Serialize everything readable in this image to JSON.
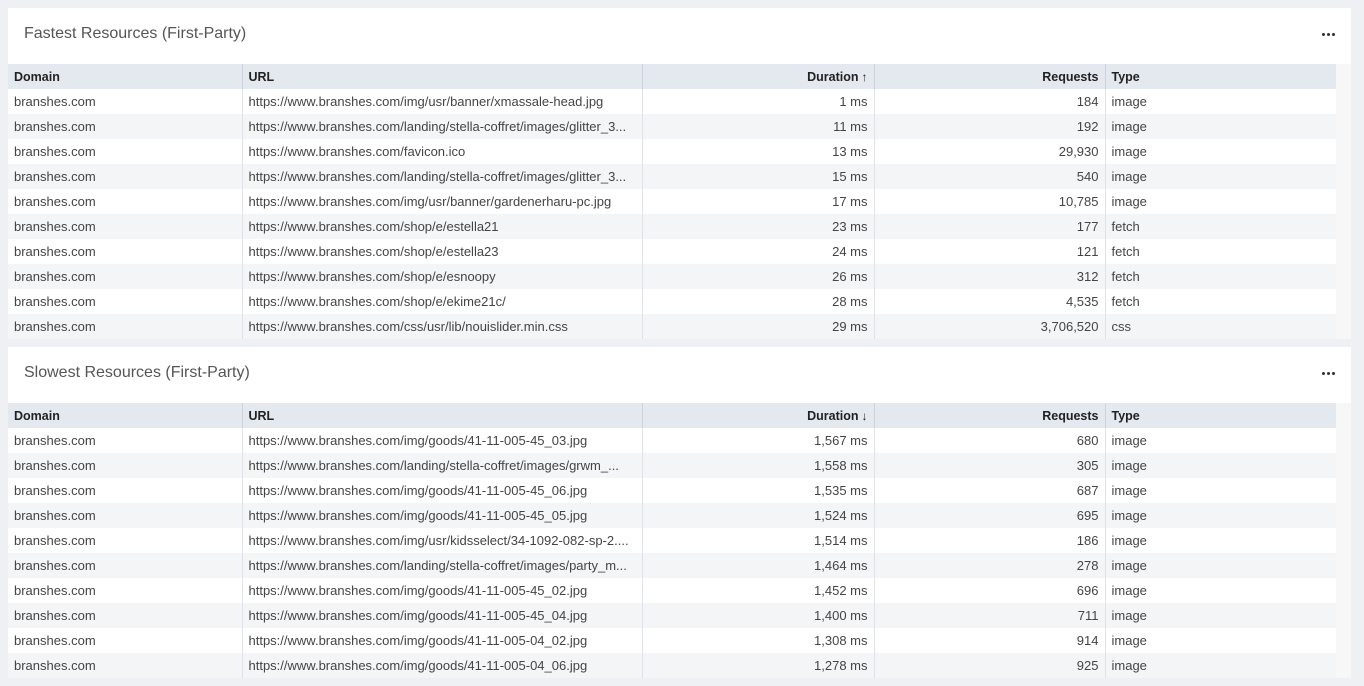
{
  "fastest": {
    "title": "Fastest Resources (First-Party)",
    "columns": {
      "domain": "Domain",
      "url": "URL",
      "duration": "Duration",
      "requests": "Requests",
      "type": "Type"
    },
    "sort_icon": "↑",
    "sort_icon_name": "sort-ascending-icon",
    "rows": [
      {
        "domain": "branshes.com",
        "url": "https://www.branshes.com/img/usr/banner/xmassale-head.jpg",
        "duration": "1 ms",
        "requests": "184",
        "type": "image"
      },
      {
        "domain": "branshes.com",
        "url": "https://www.branshes.com/landing/stella-coffret/images/glitter_3...",
        "duration": "11 ms",
        "requests": "192",
        "type": "image"
      },
      {
        "domain": "branshes.com",
        "url": "https://www.branshes.com/favicon.ico",
        "duration": "13 ms",
        "requests": "29,930",
        "type": "image"
      },
      {
        "domain": "branshes.com",
        "url": "https://www.branshes.com/landing/stella-coffret/images/glitter_3...",
        "duration": "15 ms",
        "requests": "540",
        "type": "image"
      },
      {
        "domain": "branshes.com",
        "url": "https://www.branshes.com/img/usr/banner/gardenerharu-pc.jpg",
        "duration": "17 ms",
        "requests": "10,785",
        "type": "image"
      },
      {
        "domain": "branshes.com",
        "url": "https://www.branshes.com/shop/e/estella21",
        "duration": "23 ms",
        "requests": "177",
        "type": "fetch"
      },
      {
        "domain": "branshes.com",
        "url": "https://www.branshes.com/shop/e/estella23",
        "duration": "24 ms",
        "requests": "121",
        "type": "fetch"
      },
      {
        "domain": "branshes.com",
        "url": "https://www.branshes.com/shop/e/esnoopy",
        "duration": "26 ms",
        "requests": "312",
        "type": "fetch"
      },
      {
        "domain": "branshes.com",
        "url": "https://www.branshes.com/shop/e/ekime21c/",
        "duration": "28 ms",
        "requests": "4,535",
        "type": "fetch"
      },
      {
        "domain": "branshes.com",
        "url": "https://www.branshes.com/css/usr/lib/nouislider.min.css",
        "duration": "29 ms",
        "requests": "3,706,520",
        "type": "css"
      }
    ]
  },
  "slowest": {
    "title": "Slowest Resources (First-Party)",
    "columns": {
      "domain": "Domain",
      "url": "URL",
      "duration": "Duration",
      "requests": "Requests",
      "type": "Type"
    },
    "sort_icon": "↓",
    "sort_icon_name": "sort-descending-icon",
    "rows": [
      {
        "domain": "branshes.com",
        "url": "https://www.branshes.com/img/goods/41-11-005-45_03.jpg",
        "duration": "1,567 ms",
        "requests": "680",
        "type": "image"
      },
      {
        "domain": "branshes.com",
        "url": "https://www.branshes.com/landing/stella-coffret/images/grwm_...",
        "duration": "1,558 ms",
        "requests": "305",
        "type": "image"
      },
      {
        "domain": "branshes.com",
        "url": "https://www.branshes.com/img/goods/41-11-005-45_06.jpg",
        "duration": "1,535 ms",
        "requests": "687",
        "type": "image"
      },
      {
        "domain": "branshes.com",
        "url": "https://www.branshes.com/img/goods/41-11-005-45_05.jpg",
        "duration": "1,524 ms",
        "requests": "695",
        "type": "image"
      },
      {
        "domain": "branshes.com",
        "url": "https://www.branshes.com/img/usr/kidsselect/34-1092-082-sp-2....",
        "duration": "1,514 ms",
        "requests": "186",
        "type": "image"
      },
      {
        "domain": "branshes.com",
        "url": "https://www.branshes.com/landing/stella-coffret/images/party_m...",
        "duration": "1,464 ms",
        "requests": "278",
        "type": "image"
      },
      {
        "domain": "branshes.com",
        "url": "https://www.branshes.com/img/goods/41-11-005-45_02.jpg",
        "duration": "1,452 ms",
        "requests": "696",
        "type": "image"
      },
      {
        "domain": "branshes.com",
        "url": "https://www.branshes.com/img/goods/41-11-005-45_04.jpg",
        "duration": "1,400 ms",
        "requests": "711",
        "type": "image"
      },
      {
        "domain": "branshes.com",
        "url": "https://www.branshes.com/img/goods/41-11-005-04_02.jpg",
        "duration": "1,308 ms",
        "requests": "914",
        "type": "image"
      },
      {
        "domain": "branshes.com",
        "url": "https://www.branshes.com/img/goods/41-11-005-04_06.jpg",
        "duration": "1,278 ms",
        "requests": "925",
        "type": "image"
      }
    ]
  },
  "menu_icon": "more-options-icon",
  "colors": {
    "header_bg": "#e4e8ef",
    "page_bg": "#eef0f4",
    "row_alt": "#f4f5f7"
  }
}
